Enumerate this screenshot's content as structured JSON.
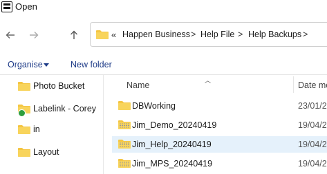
{
  "window": {
    "title": "Open"
  },
  "address": {
    "chevrons": "«",
    "crumbs": [
      "Happen Business",
      "Help File",
      "Help Backups"
    ],
    "separator": ">"
  },
  "toolbar": {
    "organise_label": "Organise",
    "new_folder_label": "New folder"
  },
  "sidebar": {
    "items": [
      {
        "label": "Photo Bucket",
        "icon": "folder-icon"
      },
      {
        "label": "Labelink - Corey",
        "icon": "synced-folder-icon"
      },
      {
        "label": "in",
        "icon": "folder-icon"
      },
      {
        "label": "Layout",
        "icon": "folder-icon"
      }
    ]
  },
  "list": {
    "columns": {
      "name": "Name",
      "date": "Date mo"
    },
    "rows": [
      {
        "name": "DBWorking",
        "date": "23/01/2",
        "icon": "folder-icon"
      },
      {
        "name": "Jim_Demo_20240419",
        "date": "19/04/2",
        "icon": "zip-folder-icon"
      },
      {
        "name": "Jim_Help_20240419",
        "date": "19/04/2",
        "icon": "zip-folder-icon",
        "selected": true
      },
      {
        "name": "Jim_MPS_20240419",
        "date": "19/04/2",
        "icon": "zip-folder-icon"
      }
    ]
  },
  "colors": {
    "folder": "#f4c542",
    "accent": "#1f3c88",
    "selection": "#e5f1fb"
  }
}
